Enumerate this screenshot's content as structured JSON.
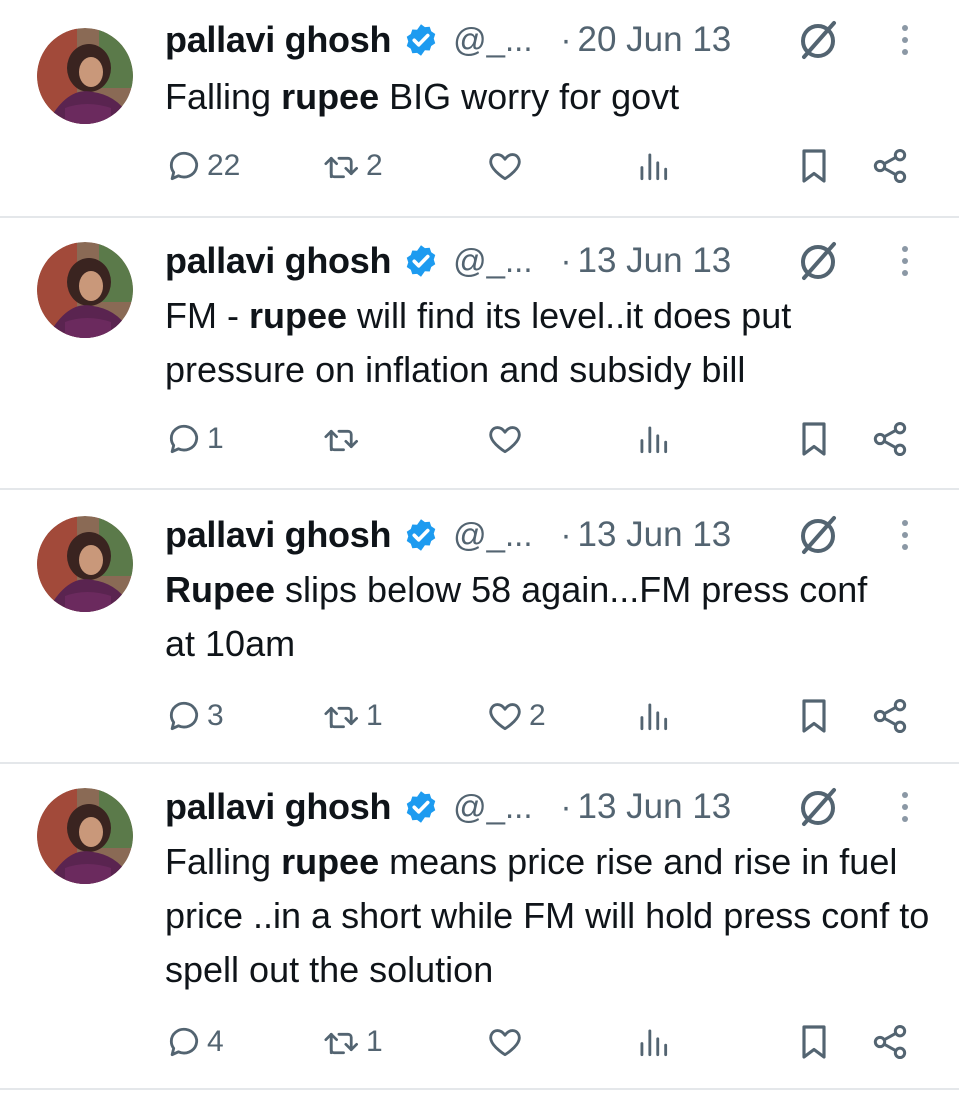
{
  "tweets": [
    {
      "author": "pallavi ghosh",
      "handle": "@_...",
      "dot": "·",
      "date": "20 Jun 13",
      "text_parts": [
        "Falling ",
        "rupee",
        " BIG worry for govt"
      ],
      "replies": "22",
      "retweets": "2",
      "likes": ""
    },
    {
      "author": "pallavi ghosh",
      "handle": "@_...",
      "dot": "·",
      "date": "13 Jun 13",
      "text_parts": [
        "FM - ",
        "rupee",
        " will find its level..it does put pressure on inflation and subsidy bill"
      ],
      "replies": "1",
      "retweets": "",
      "likes": ""
    },
    {
      "author": "pallavi ghosh",
      "handle": "@_...",
      "dot": "·",
      "date": "13 Jun 13",
      "text_parts": [
        "",
        "Rupee",
        " slips below 58 again...FM press conf at 10am"
      ],
      "replies": "3",
      "retweets": "1",
      "likes": "2"
    },
    {
      "author": "pallavi ghosh",
      "handle": "@_...",
      "dot": "·",
      "date": "13 Jun 13",
      "text_parts": [
        "Falling ",
        "rupee",
        " means price rise and rise in fuel price ..in a short while FM will hold press conf to spell out the solution"
      ],
      "replies": "4",
      "retweets": "1",
      "likes": ""
    }
  ],
  "colors": {
    "text": "#0f1419",
    "secondary": "#536471",
    "verified": "#1d9bf0",
    "divider": "#e4e7ea"
  },
  "icons": [
    "reply-icon",
    "retweet-icon",
    "like-icon",
    "views-icon",
    "bookmark-icon",
    "share-icon",
    "grok-icon",
    "more-icon",
    "verified-badge-icon"
  ]
}
